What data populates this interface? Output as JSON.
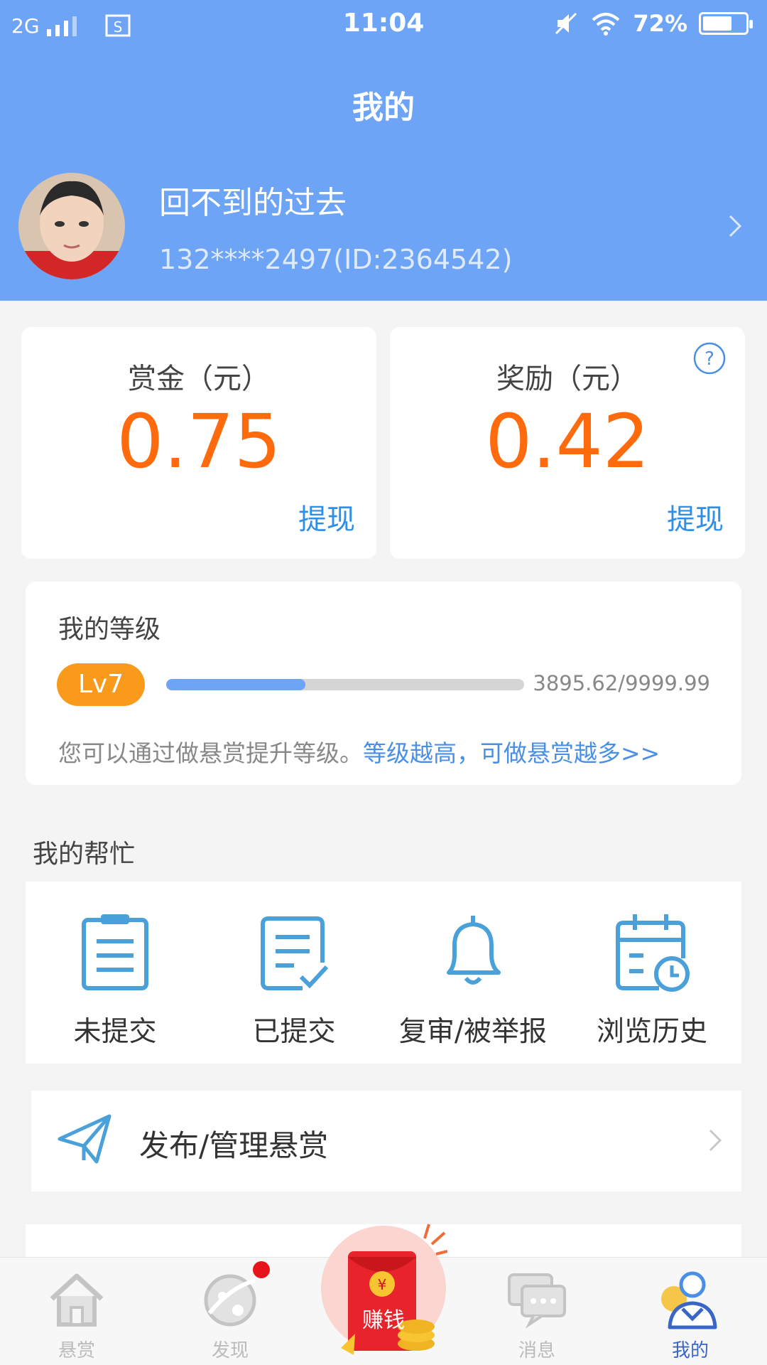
{
  "status_bar": {
    "network": "2G",
    "time": "11:04",
    "battery": "72%",
    "battery_level": 0.72
  },
  "page_title": "我的",
  "profile": {
    "name": "回不到的过去",
    "id_text": "132****2497(ID:2364542)"
  },
  "balances": [
    {
      "label": "赏金（元）",
      "value": "0.75",
      "action": "提现"
    },
    {
      "label": "奖励（元）",
      "value": "0.42",
      "action": "提现"
    }
  ],
  "level": {
    "title": "我的等级",
    "badge": "Lv7",
    "progress_text": "3895.62/9999.99",
    "progress": 0.3896,
    "tip": "您可以通过做悬赏提升等级。",
    "tip_link": "等级越高，可做悬赏越多>>"
  },
  "help": {
    "title": "我的帮忙",
    "items": [
      {
        "label": "未提交",
        "icon": "clipboard-icon"
      },
      {
        "label": "已提交",
        "icon": "checked-document-icon"
      },
      {
        "label": "复审/被举报",
        "icon": "bell-icon"
      },
      {
        "label": "浏览历史",
        "icon": "calendar-clock-icon"
      }
    ]
  },
  "manage": {
    "label": "发布/管理悬赏",
    "icon": "paper-plane-icon"
  },
  "tabs": [
    {
      "label": "悬赏",
      "icon": "home-icon"
    },
    {
      "label": "发现",
      "icon": "planet-icon",
      "badge_dot": true
    },
    {
      "label": "赚钱",
      "icon": "red-envelope-icon"
    },
    {
      "label": "消息",
      "icon": "chat-icon"
    },
    {
      "label": "我的",
      "icon": "user-icon",
      "active": true
    }
  ],
  "colors": {
    "header": "#6ea4f6",
    "accent_orange": "#ff6a0d",
    "link_blue": "#2f8ee8",
    "level_badge": "#f99a1b",
    "tab_active": "#3a66c8"
  }
}
